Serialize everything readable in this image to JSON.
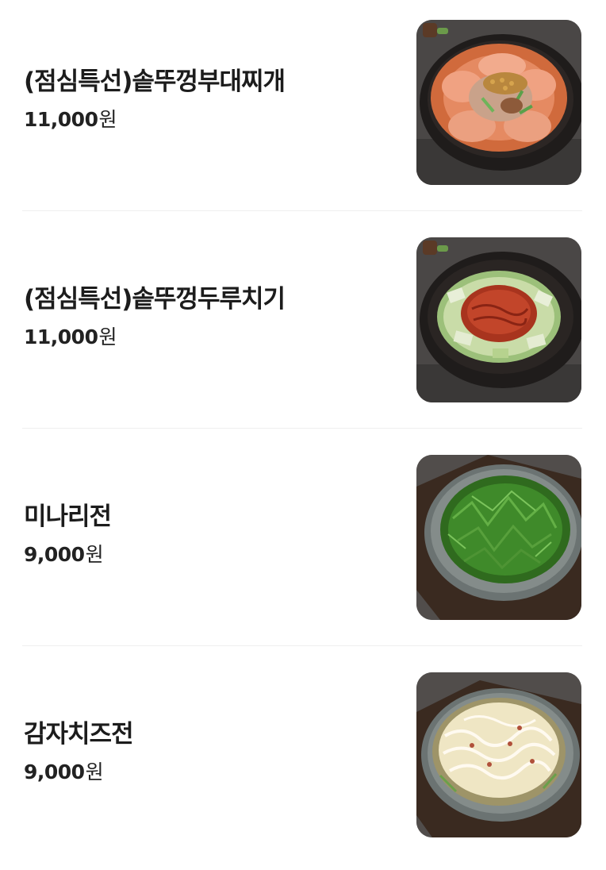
{
  "menu": {
    "items": [
      {
        "name": "(점심특선)솥뚜껑부대찌개",
        "price": "11,000",
        "currency": "원",
        "photo": "budae-jjigae-photo"
      },
      {
        "name": "(점심특선)솥뚜껑두루치기",
        "price": "11,000",
        "currency": "원",
        "photo": "duruchigi-photo"
      },
      {
        "name": "미나리전",
        "price": "9,000",
        "currency": "원",
        "photo": "minari-jeon-photo"
      },
      {
        "name": "감자치즈전",
        "price": "9,000",
        "currency": "원",
        "photo": "potato-cheese-jeon-photo"
      }
    ]
  },
  "colors": {
    "background": "#ffffff",
    "text": "#1f1f1f",
    "divider": "#efefef",
    "photo_backdrop": "#3f3d3c"
  }
}
